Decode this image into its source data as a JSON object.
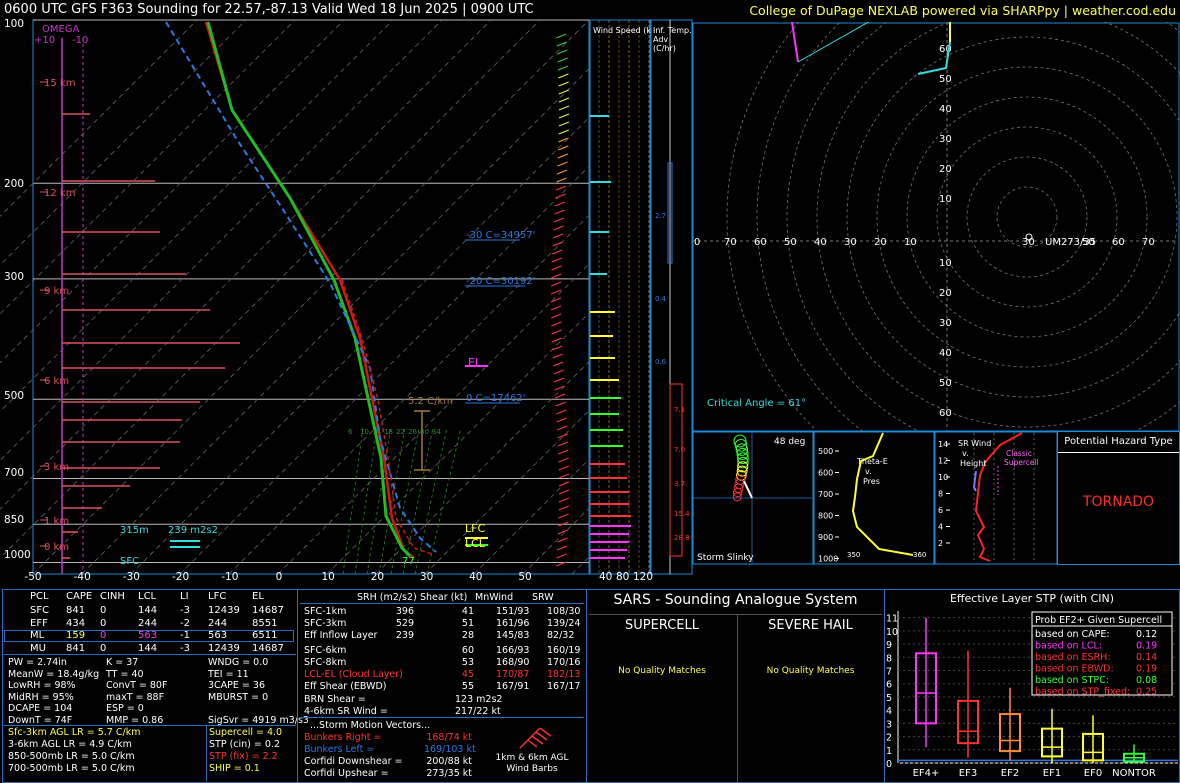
{
  "header": {
    "title_left": "0600 UTC GFS F363 Sounding for 22.57,-87.13 Valid  Wed 18 Jun 2025 | 0900 UTC",
    "title_right": "College of DuPage NEXLAB powered via SHARPpy | weather.cod.edu"
  },
  "skewt": {
    "p_ticks": [
      "100",
      "200",
      "300",
      "500",
      "700",
      "850",
      "1000"
    ],
    "t_ticks": [
      "-50",
      "-40",
      "-30",
      "-20",
      "-10",
      "0",
      "10",
      "20",
      "30",
      "40",
      "50"
    ],
    "height_labels": [
      "15 km",
      "12 km",
      "9 km",
      "6 km",
      "3 km",
      "1 km",
      "0 km"
    ],
    "omega_label": "OMEGA",
    "omega_ticks": [
      "+10",
      "-10"
    ],
    "annotations": {
      "c30": "-30 C=34957'",
      "c20": "-20 C=30192'",
      "el": "EL",
      "c0": "0 C=17462'",
      "lapse": "5.2 C/km",
      "lfc": "LFC",
      "lcl": "LCL",
      "srh_h": "315m",
      "srh_v": "239 m2s2",
      "sfc": "SFC",
      "sfc_t": "77",
      "mix": [
        "6",
        "10",
        "14",
        "18",
        "22",
        "26",
        "30",
        "34"
      ]
    }
  },
  "wind_speed": {
    "title": "Wind Speed (knots)",
    "ticks": [
      "40",
      "80",
      "120"
    ]
  },
  "inf_temp": {
    "title": "Inf. Temp. Adv (C/hr)",
    "vals": [
      "2.7",
      "0.4",
      "0.6",
      "7.1",
      "7.0",
      "3.7",
      "15.4",
      "28.8"
    ]
  },
  "hodo": {
    "rings_x": [
      "70",
      "60",
      "50",
      "40",
      "30",
      "20",
      "10",
      "10",
      "20",
      "30",
      "40",
      "50",
      "60",
      "70"
    ],
    "rings_y_top": [
      "60",
      "50",
      "40",
      "30",
      "20",
      "10"
    ],
    "rings_y_bot": [
      "10",
      "20",
      "30",
      "40",
      "50",
      "60"
    ],
    "um_label": "UM273/35",
    "critical": "Critical Angle = 61°"
  },
  "slinky": {
    "deg": "48 deg",
    "label": "Storm Slinky"
  },
  "thetae": {
    "label": "Theta-E v. Pres",
    "p": [
      "500",
      "600",
      "700",
      "800",
      "900",
      "1000"
    ],
    "x": [
      "350",
      "360"
    ]
  },
  "srwind": {
    "label": "SR Wind v. Height",
    "classic": "Classic Supercell",
    "h": [
      "14",
      "12",
      "10",
      "8",
      "6",
      "4",
      "2"
    ],
    "x": [
      "2",
      "4",
      "6",
      "8"
    ]
  },
  "hazard": {
    "title": "Potential Hazard Type",
    "value": "TORNADO"
  },
  "parcels": {
    "headers": [
      "PCL",
      "CAPE",
      "CINH",
      "LCL",
      "LI",
      "LFC",
      "EL"
    ],
    "rows": [
      [
        "SFC",
        "841",
        "0",
        "144",
        "-3",
        "12439",
        "14687"
      ],
      [
        "EFF",
        "434",
        "0",
        "244",
        "-2",
        "244",
        "8551"
      ],
      [
        "ML",
        "159",
        "0",
        "563",
        "-1",
        "563",
        "6511"
      ],
      [
        "MU",
        "841",
        "0",
        "144",
        "-3",
        "12439",
        "14687"
      ]
    ]
  },
  "indices": [
    [
      "PW = 2.74in",
      "K = 37",
      "WNDG = 0.0"
    ],
    [
      "MeanW = 18.4g/kg",
      "TT = 40",
      "TEI = 11"
    ],
    [
      "LowRH = 98%",
      "ConvT = 80F",
      "3CAPE = 36"
    ],
    [
      "MidRH = 95%",
      "maxT = 88F",
      "MBURST = 0"
    ],
    [
      "DCAPE = 104",
      "ESP = 0",
      ""
    ],
    [
      "DownT = 74F",
      "MMP = 0.86",
      "SigSvr = 4919 m3/s3"
    ]
  ],
  "lapse": [
    "Sfc-3km AGL LR = 5.7 C/km",
    "3-6km AGL LR = 4.9 C/km",
    "850-500mb LR = 5.0 C/km",
    "700-500mb LR = 5.0 C/km"
  ],
  "composites": [
    "Supercell = 4.0",
    "STP (cin) = 0.2",
    "STP (fix) = 2.2",
    "SHIP = 0.1"
  ],
  "kinematics": {
    "headers": [
      "SRH (m2/s2)",
      "Shear (kt)",
      "MnWind",
      "SRW"
    ],
    "rows": [
      [
        "SFC-1km",
        "396",
        "41",
        "151/93",
        "108/30"
      ],
      [
        "SFC-3km",
        "529",
        "51",
        "161/96",
        "139/24"
      ],
      [
        "Eff Inflow Layer",
        "239",
        "28",
        "145/83",
        "82/32"
      ],
      [
        "",
        ""
      ],
      [
        "SFC-6km",
        "",
        "60",
        "166/93",
        "160/19"
      ],
      [
        "SFC-8km",
        "",
        "53",
        "168/90",
        "170/16"
      ],
      [
        "LCL-EL (Cloud Layer)",
        "",
        "45",
        "170/87",
        "182/13"
      ],
      [
        "Eff Shear (EBWD)",
        "",
        "55",
        "167/91",
        "167/17"
      ]
    ],
    "brn": [
      "BRN Shear =",
      "123 m2s2"
    ],
    "sr46": [
      "4-6km SR Wind =",
      "217/22 kt"
    ],
    "storm_title": "...Storm Motion Vectors...",
    "storm": [
      [
        "Bunkers Right =",
        "168/74 kt"
      ],
      [
        "Bunkers Left =",
        "169/103 kt"
      ],
      [
        "Corfidi Downshear =",
        "200/88 kt"
      ],
      [
        "Corfidi Upshear =",
        "273/35 kt"
      ]
    ],
    "barb_label": "1km & 6km AGL Wind Barbs"
  },
  "sars": {
    "title": "SARS - Sounding Analogue System",
    "supercell": "SUPERCELL",
    "hail": "SEVERE HAIL",
    "nq1": "No Quality Matches",
    "nq2": "No Quality Matches"
  },
  "stp": {
    "title": "Effective Layer STP (with CIN)",
    "prob_title": "Prob EF2+ Given Supercell",
    "prob": [
      [
        "based on CAPE:",
        "0.12",
        "#ffffff"
      ],
      [
        "based on LCL:",
        "0.19",
        "#ff33ff"
      ],
      [
        "based on ESRH:",
        "0.14",
        "#ff3333"
      ],
      [
        "based on EBWD:",
        "0.19",
        "#ff3333"
      ],
      [
        "based on STPC:",
        "0.08",
        "#33ff33"
      ],
      [
        "based on STP_fixed:",
        "0.25",
        "#ff3333"
      ]
    ],
    "y_ticks": [
      "0",
      "1",
      "2",
      "3",
      "4",
      "5",
      "6",
      "7",
      "8",
      "9",
      "10",
      "11"
    ],
    "categories": [
      "EF4+",
      "EF3",
      "EF2",
      "EF1",
      "EF0",
      "NONTOR"
    ]
  },
  "chart_data": {
    "type": "box",
    "title": "Effective Layer STP (with CIN)",
    "categories": [
      "EF4+",
      "EF3",
      "EF2",
      "EF1",
      "EF0",
      "NONTOR"
    ],
    "whisker_low": [
      1.2,
      0.4,
      0.2,
      0.0,
      0.0,
      0.0
    ],
    "q1": [
      3.0,
      1.5,
      0.9,
      0.5,
      0.2,
      0.1
    ],
    "median": [
      5.3,
      2.4,
      1.7,
      1.2,
      0.8,
      0.4
    ],
    "q3": [
      8.3,
      4.7,
      3.7,
      2.6,
      2.2,
      0.7
    ],
    "whisker_high": [
      11.0,
      8.5,
      5.7,
      4.1,
      3.6,
      1.4
    ],
    "colors": [
      "#ff33ff",
      "#ff3333",
      "#ff8c33",
      "#ffff33",
      "#ffff33",
      "#33ff33"
    ],
    "ylim": [
      0,
      11.5
    ],
    "current_value": 0.2
  }
}
